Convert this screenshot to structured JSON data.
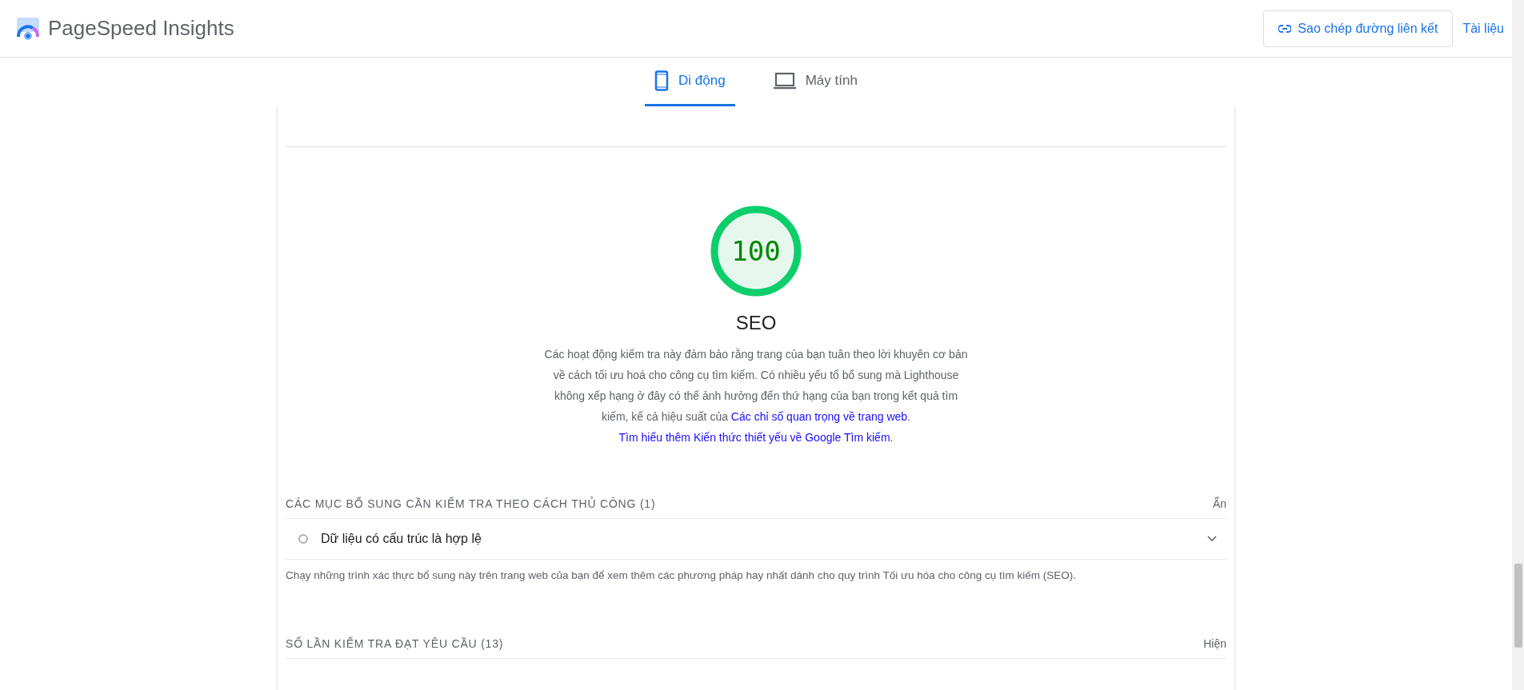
{
  "header": {
    "title": "PageSpeed Insights",
    "copy_link_button": "Sao chép đường liên kết",
    "docs_link": "Tài liệu"
  },
  "tabs": [
    {
      "label": "Di động",
      "kind": "mobile",
      "selected": true
    },
    {
      "label": "Máy tính",
      "kind": "desktop",
      "selected": false
    }
  ],
  "score": {
    "value": "100",
    "title": "SEO",
    "description": [
      {
        "kind": "text",
        "text": "Các hoạt động kiểm tra này đảm bảo rằng trang của bạn tuân theo lời khuyên cơ bản về cách tối ưu hoá cho công cụ tìm kiếm. Có nhiều yếu tố bổ sung mà Lighthouse không xếp hạng ở đây có thể ảnh hưởng đến thứ hạng của bạn trong kết quả tìm kiếm, kể cả hiệu suất của "
      },
      {
        "kind": "link",
        "text": "Các chỉ số quan trọng về trang web"
      },
      {
        "kind": "text",
        "text": ". "
      },
      {
        "kind": "link",
        "text": "Tìm hiểu thêm Kiến thức thiết yếu về Google Tìm kiếm"
      },
      {
        "kind": "text",
        "text": "."
      }
    ]
  },
  "sections": [
    {
      "title": "CÁC MỤC BỔ SUNG CẦN KIỂM TRA THEO CÁCH THỦ CÔNG",
      "count": "(1)",
      "toggle": "Ẩn",
      "items": [
        {
          "label": "Dữ liệu có cấu trúc là hợp lệ"
        }
      ],
      "note": "Chạy những trình xác thực bổ sung này trên trang web của bạn để xem thêm các phương pháp hay nhất dành cho quy trình Tối ưu hóa cho công cụ tìm kiếm (SEO)."
    },
    {
      "title": "SỐ LẦN KIỂM TRA ĐẠT YÊU CẦU",
      "count": "(13)",
      "toggle": "Hiện"
    }
  ]
}
